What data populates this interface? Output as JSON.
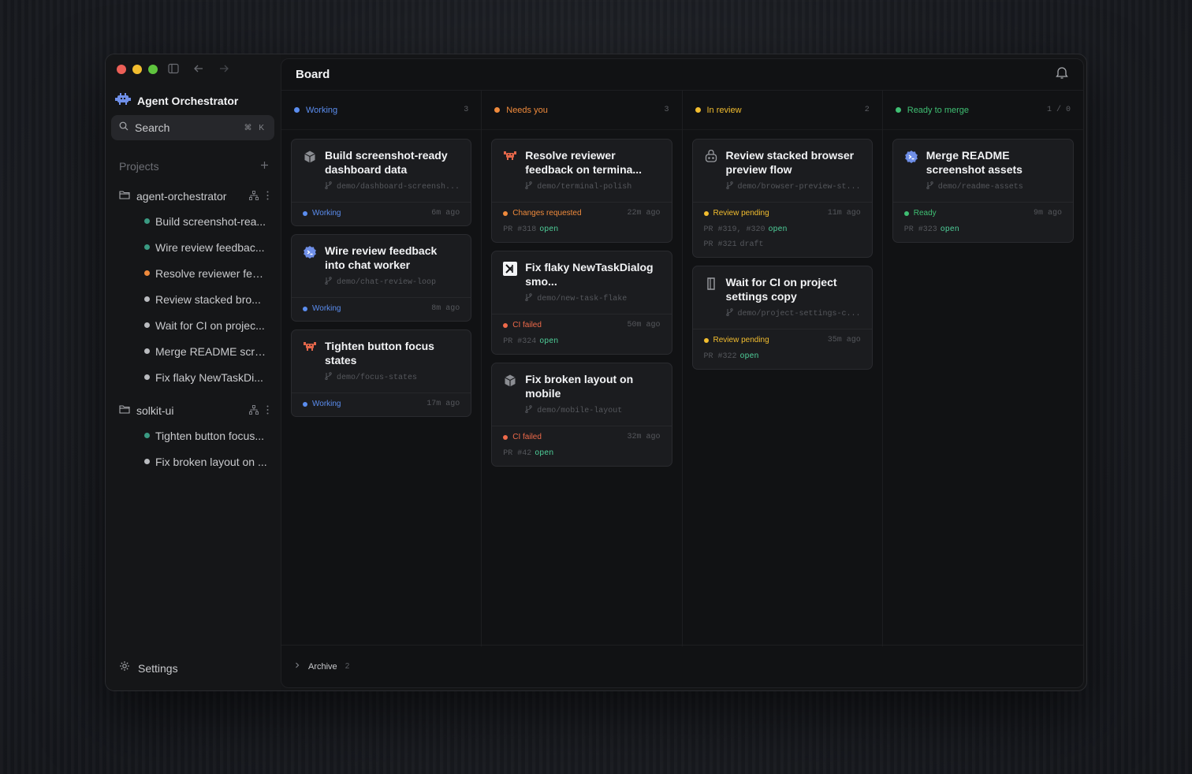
{
  "sidebar": {
    "app_title": "Agent Orchestrator",
    "search": {
      "label": "Search",
      "shortcut": "⌘ K"
    },
    "projects_label": "Projects",
    "groups": [
      {
        "name": "agent-orchestrator",
        "items": [
          {
            "label": "Build screenshot-rea...",
            "color": "#3a9a82"
          },
          {
            "label": "Wire review feedbac...",
            "color": "#3a9a82"
          },
          {
            "label": "Resolve reviewer fee...",
            "color": "#ef8a3c"
          },
          {
            "label": "Review stacked bro...",
            "color": "#b9bbbf"
          },
          {
            "label": "Wait for CI on projec...",
            "color": "#b9bbbf"
          },
          {
            "label": "Merge README scre...",
            "color": "#b9bbbf"
          },
          {
            "label": "Fix flaky NewTaskDi...",
            "color": "#b9bbbf"
          }
        ]
      },
      {
        "name": "solkit-ui",
        "items": [
          {
            "label": "Tighten button focus...",
            "color": "#3a9a82"
          },
          {
            "label": "Fix broken layout on ...",
            "color": "#b9bbbf"
          }
        ]
      }
    ],
    "settings_label": "Settings"
  },
  "board": {
    "title": "Board",
    "columns": [
      {
        "title": "Working",
        "count": "3",
        "color": "#5b8def",
        "cards": [
          {
            "icon": "cube-icon",
            "title": "Build screenshot-ready dashboard data",
            "branch": "demo/dashboard-screensh...",
            "status": "Working",
            "status_color": "#5b8def",
            "time": "6m ago",
            "pr": []
          },
          {
            "icon": "claude-badge-icon",
            "title": "Wire review feedback into chat worker",
            "branch": "demo/chat-review-loop",
            "status": "Working",
            "status_color": "#5b8def",
            "time": "8m ago",
            "pr": []
          },
          {
            "icon": "crab-icon",
            "title": "Tighten button focus states",
            "branch": "demo/focus-states",
            "status": "Working",
            "status_color": "#5b8def",
            "time": "17m ago",
            "pr": []
          }
        ]
      },
      {
        "title": "Needs you",
        "count": "3",
        "color": "#ef8a3c",
        "cards": [
          {
            "icon": "crab-icon",
            "title": "Resolve reviewer feedback on termina...",
            "branch": "demo/terminal-polish",
            "status": "Changes requested",
            "status_color": "#ef8a3c",
            "time": "22m ago",
            "pr": [
              {
                "text": "PR #318",
                "state": "open"
              }
            ]
          },
          {
            "icon": "x-logo-icon",
            "title": "Fix flaky NewTaskDialog smo...",
            "branch": "demo/new-task-flake",
            "status": "CI failed",
            "status_color": "#ef6a4a",
            "time": "50m ago",
            "pr": [
              {
                "text": "PR #324",
                "state": "open"
              }
            ]
          },
          {
            "icon": "cube-icon",
            "title": "Fix broken layout on mobile",
            "branch": "demo/mobile-layout",
            "status": "CI failed",
            "status_color": "#ef6a4a",
            "time": "32m ago",
            "pr": [
              {
                "text": "PR #42",
                "state": "open"
              }
            ]
          }
        ]
      },
      {
        "title": "In review",
        "count": "2",
        "color": "#f2bd2f",
        "cards": [
          {
            "icon": "robot-icon",
            "title": "Review stacked browser preview flow",
            "branch": "demo/browser-preview-st...",
            "status": "Review pending",
            "status_color": "#f2bd2f",
            "time": "11m ago",
            "pr": [
              {
                "text": "PR #319, #320",
                "state": "open"
              },
              {
                "text": "PR #321",
                "state": "draft"
              }
            ]
          },
          {
            "icon": "bracket-icon",
            "title": "Wait for CI on project settings copy",
            "branch": "demo/project-settings-c...",
            "status": "Review pending",
            "status_color": "#f2bd2f",
            "time": "35m ago",
            "pr": [
              {
                "text": "PR #322",
                "state": "open"
              }
            ]
          }
        ]
      },
      {
        "title": "Ready to merge",
        "count": "1 / 0",
        "color": "#3fbf73",
        "cards": [
          {
            "icon": "claude-badge-icon",
            "title": "Merge README screenshot assets",
            "branch": "demo/readme-assets",
            "status": "Ready",
            "status_color": "#3fbf73",
            "time": "9m ago",
            "pr": [
              {
                "text": "PR #323",
                "state": "open"
              }
            ]
          }
        ]
      }
    ],
    "archive": {
      "label": "Archive",
      "count": "2"
    }
  }
}
